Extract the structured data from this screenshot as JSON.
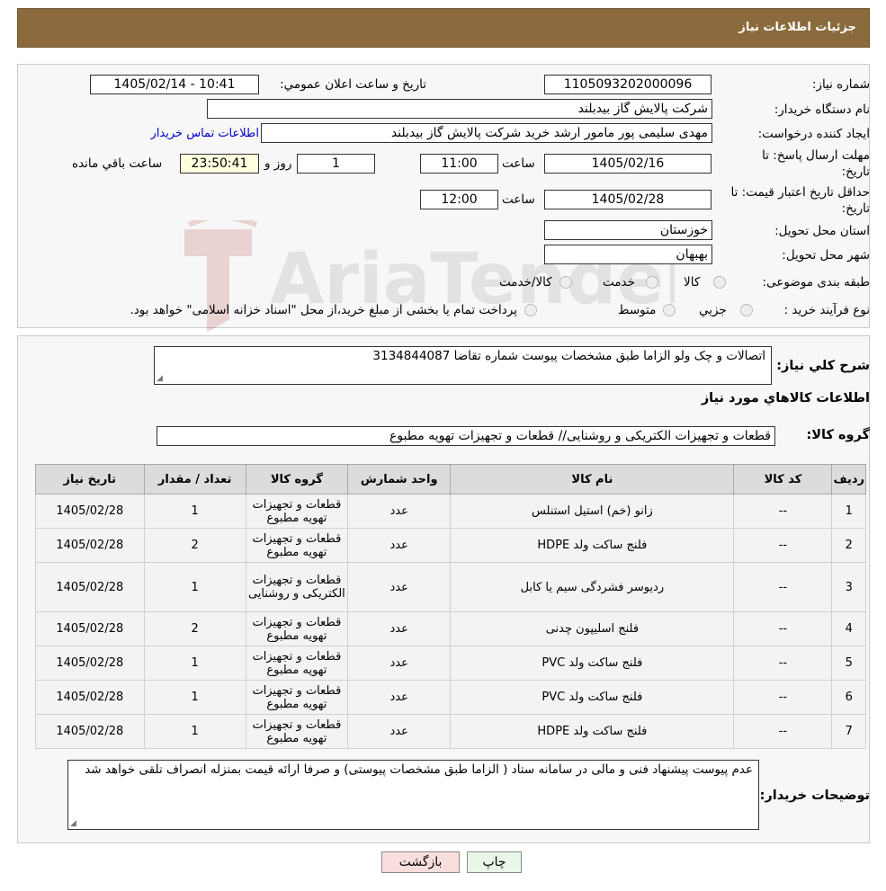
{
  "header": {
    "title": "جزئیات اطلاعات نیاز"
  },
  "form": {
    "need_number_label": "شماره نیاز:",
    "need_number": "1105093202000096",
    "announce_label": "تاریخ و ساعت اعلان عمومي:",
    "announce_value": "1405/02/14 - 10:41",
    "buyer_org_label": "نام دستگاه خریدار:",
    "buyer_org": "شرکت پالایش گاز بیدبلند",
    "creator_label": "ایجاد کننده درخواست:",
    "creator": "مهدی سلیمی پور مامور ارشد خرید شرکت پالایش گاز بیدبلند",
    "contact_link": "اطلاعات تماس خریدار",
    "deadline_label_1": "مهلت ارسال پاسخ: تا",
    "deadline_label_2": "تاریخ:",
    "deadline_date": "1405/02/16",
    "time_label": "ساعت",
    "deadline_time": "11:00",
    "days": "1",
    "days_label": "روز و",
    "remaining_time": "23:50:41",
    "remaining_label": "ساعت باقي مانده",
    "validity_label_1": "حداقل تاریخ اعتبار قیمت: تا",
    "validity_label_2": "تاریخ:",
    "validity_date": "1405/02/28",
    "validity_time": "12:00",
    "province_label": "استان محل تحویل:",
    "province": "خوزستان",
    "city_label": "شهر محل تحویل:",
    "city": "بهبهان",
    "category_label": "طبقه بندی موضوعی:",
    "category_options": [
      "کالا",
      "خدمت",
      "کالا/خدمت"
    ],
    "purchase_type_label": "نوع فرآیند خرید :",
    "purchase_options": [
      "جزیي",
      "متوسط"
    ],
    "purchase_note": "پرداخت تمام یا بخشی از مبلغ خرید،از محل \"اسناد خزانه اسلامی\" خواهد بود."
  },
  "summary": {
    "label": "شرح کلي نياز:",
    "value": "اتصالات و چک ولو  الزاما طبق مشخصات پیوست شماره تقاضا 3134844087"
  },
  "goods_section": {
    "title": "اطلاعات کالاهاي مورد نياز",
    "group_label": "گروه کالا:",
    "group_value": "قطعات و تجهیزات الکتریکی و روشنایی//  قطعات و تجهیزات تهویه مطبوع"
  },
  "table": {
    "headers": [
      "رديف",
      "کد کالا",
      "نام کالا",
      "واحد شمارش",
      "گروه کالا",
      "تعداد / مقدار",
      "تاريخ نياز"
    ],
    "rows": [
      [
        "1",
        "--",
        "زانو (خم) استیل استنلس",
        "عدد",
        "قطعات و تجهیزات تهویه مطبوع",
        "1",
        "1405/02/28"
      ],
      [
        "2",
        "--",
        "فلنج ساکت ولد HDPE",
        "عدد",
        "قطعات و تجهیزات تهویه مطبوع",
        "2",
        "1405/02/28"
      ],
      [
        "3",
        "--",
        "ردیوسر فشردگی سیم یا کابل",
        "عدد",
        "قطعات و تجهیزات الکتریکی و روشنایی",
        "1",
        "1405/02/28"
      ],
      [
        "4",
        "--",
        "فلنج اسلیپون چدنی",
        "عدد",
        "قطعات و تجهیزات تهویه مطبوع",
        "2",
        "1405/02/28"
      ],
      [
        "5",
        "--",
        "فلنج ساکت ولد PVC",
        "عدد",
        "قطعات و تجهیزات تهویه مطبوع",
        "1",
        "1405/02/28"
      ],
      [
        "6",
        "--",
        "فلنج ساکت ولد PVC",
        "عدد",
        "قطعات و تجهیزات تهویه مطبوع",
        "1",
        "1405/02/28"
      ],
      [
        "7",
        "--",
        "فلنج ساکت ولد HDPE",
        "عدد",
        "قطعات و تجهیزات تهویه مطبوع",
        "1",
        "1405/02/28"
      ]
    ]
  },
  "buyer_notes": {
    "label": "توضيحات خريدار:",
    "value": "عدم پیوست پیشنهاد فنی و مالی در سامانه ستاد ( الزاما طبق مشخصات پیوستی)  و صرفا ارائه قیمت بمنزله انصراف تلقی خواهد شد"
  },
  "buttons": {
    "print": "چاپ",
    "back": "بازگشت"
  },
  "watermark": {
    "text": "AriaTender.neT"
  },
  "colors": {
    "header_bg": "#8b6b3d",
    "link": "#0000cc",
    "back_button_bg": "#f9dede",
    "print_button_bg": "#e9f7e9"
  }
}
